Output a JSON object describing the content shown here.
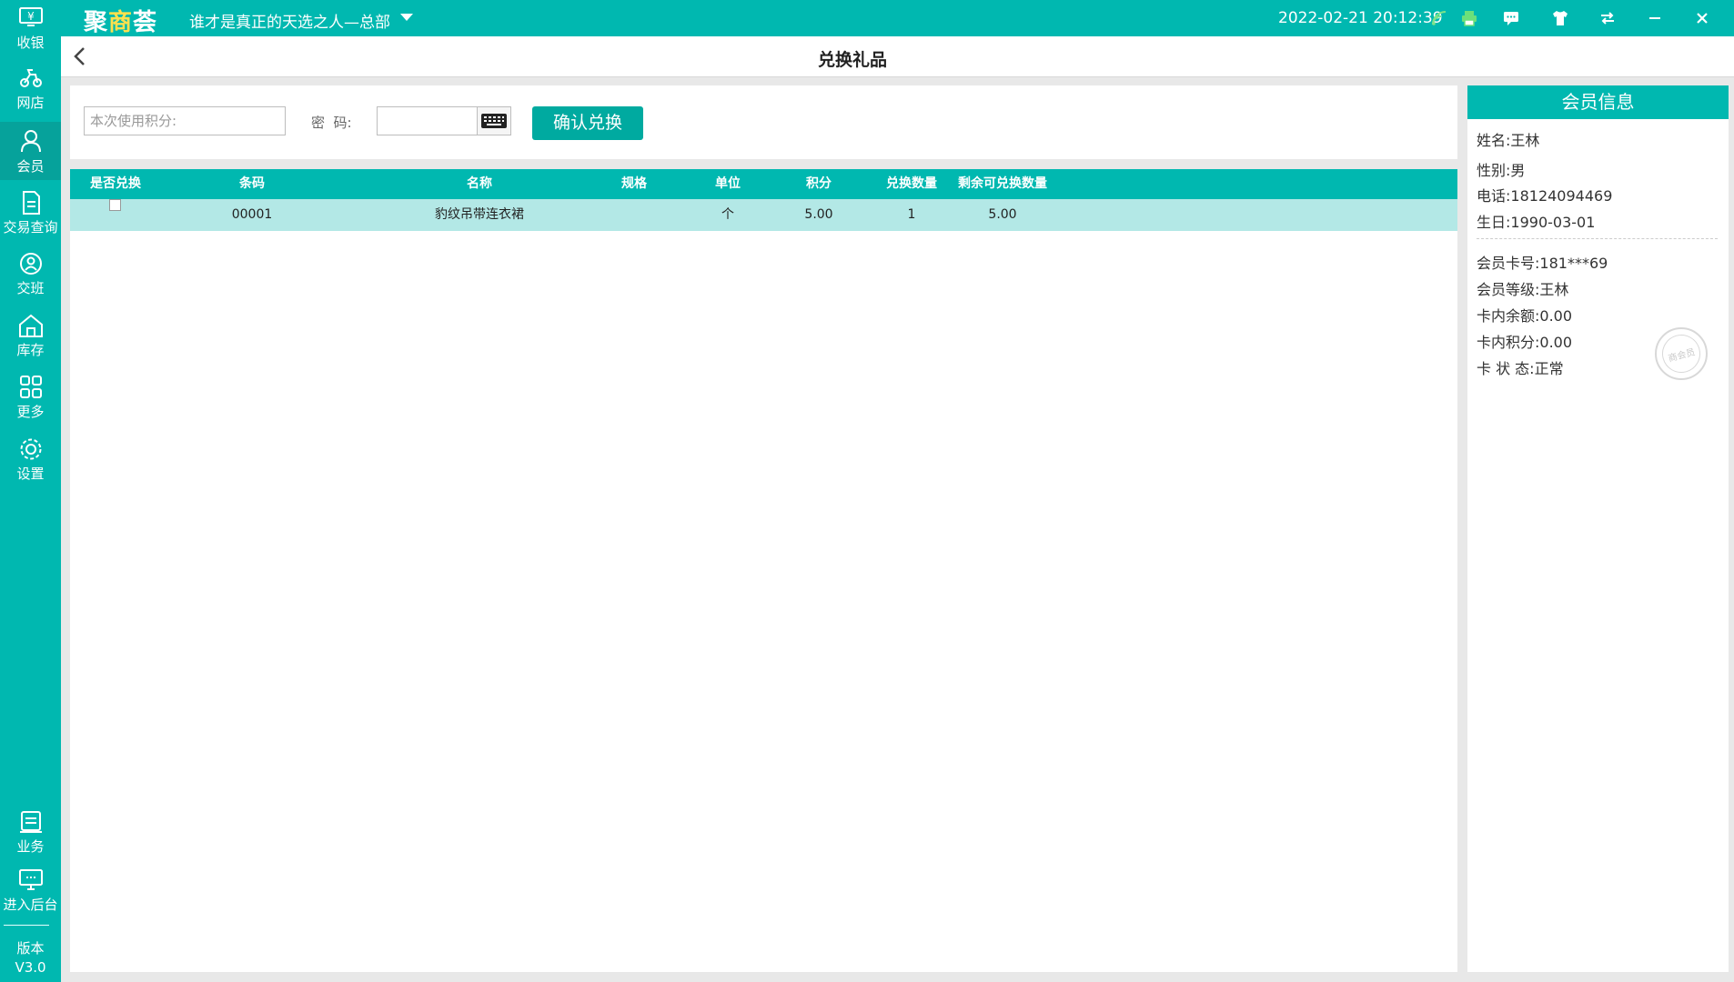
{
  "app": {
    "logo_text": "聚商荟",
    "store_name": "谁才是真正的天选之人—总部",
    "datetime": "2022-02-21 20:12:39",
    "accent_color": "#00b8b0"
  },
  "sidebar": {
    "items": [
      {
        "label": "收银",
        "icon": "cashier-icon"
      },
      {
        "label": "网店",
        "icon": "online-store-icon"
      },
      {
        "label": "会员",
        "icon": "member-icon",
        "active": true
      },
      {
        "label": "交易查询",
        "icon": "transaction-query-icon"
      },
      {
        "label": "交班",
        "icon": "shift-handover-icon"
      },
      {
        "label": "库存",
        "icon": "inventory-icon"
      },
      {
        "label": "更多",
        "icon": "more-grid-icon"
      },
      {
        "label": "设置",
        "icon": "settings-gear-icon"
      }
    ],
    "bottom_items": [
      {
        "label": "业务",
        "icon": "business-icon"
      },
      {
        "label": "进入后台",
        "icon": "backend-monitor-icon"
      }
    ],
    "version_label": "版本",
    "version_value": "V3.0"
  },
  "page": {
    "title": "兑换礼品"
  },
  "exchange_form": {
    "points_placeholder": "本次使用积分:",
    "password_label": "密  码:",
    "password_value": "",
    "confirm_label": "确认兑换"
  },
  "table": {
    "columns": [
      "是否兑换",
      "条码",
      "名称",
      "规格",
      "单位",
      "积分",
      "兑换数量",
      "剩余可兑换数量"
    ],
    "rows": [
      {
        "selected": false,
        "barcode": "00001",
        "name": "豹纹吊带连衣裙",
        "spec": "",
        "unit": "个",
        "points": "5.00",
        "quantity": "1",
        "remaining": "5.00"
      }
    ]
  },
  "member": {
    "header": "会员信息",
    "name_label": "姓名:",
    "name": "王林",
    "gender_label": "性别:",
    "gender": "男",
    "phone_label": "电话:",
    "phone": "18124094469",
    "birthday_label": "生日:",
    "birthday": "1990-03-01",
    "card_no_label": "会员卡号:",
    "card_no": "181***69",
    "level_label": "会员等级:",
    "level": "王林",
    "balance_label": "卡内余额:",
    "balance": "0.00",
    "points_label": "卡内积分:",
    "points": "0.00",
    "status_label": "卡 状 态:",
    "status": "正常",
    "stamp_text": "商会员"
  }
}
